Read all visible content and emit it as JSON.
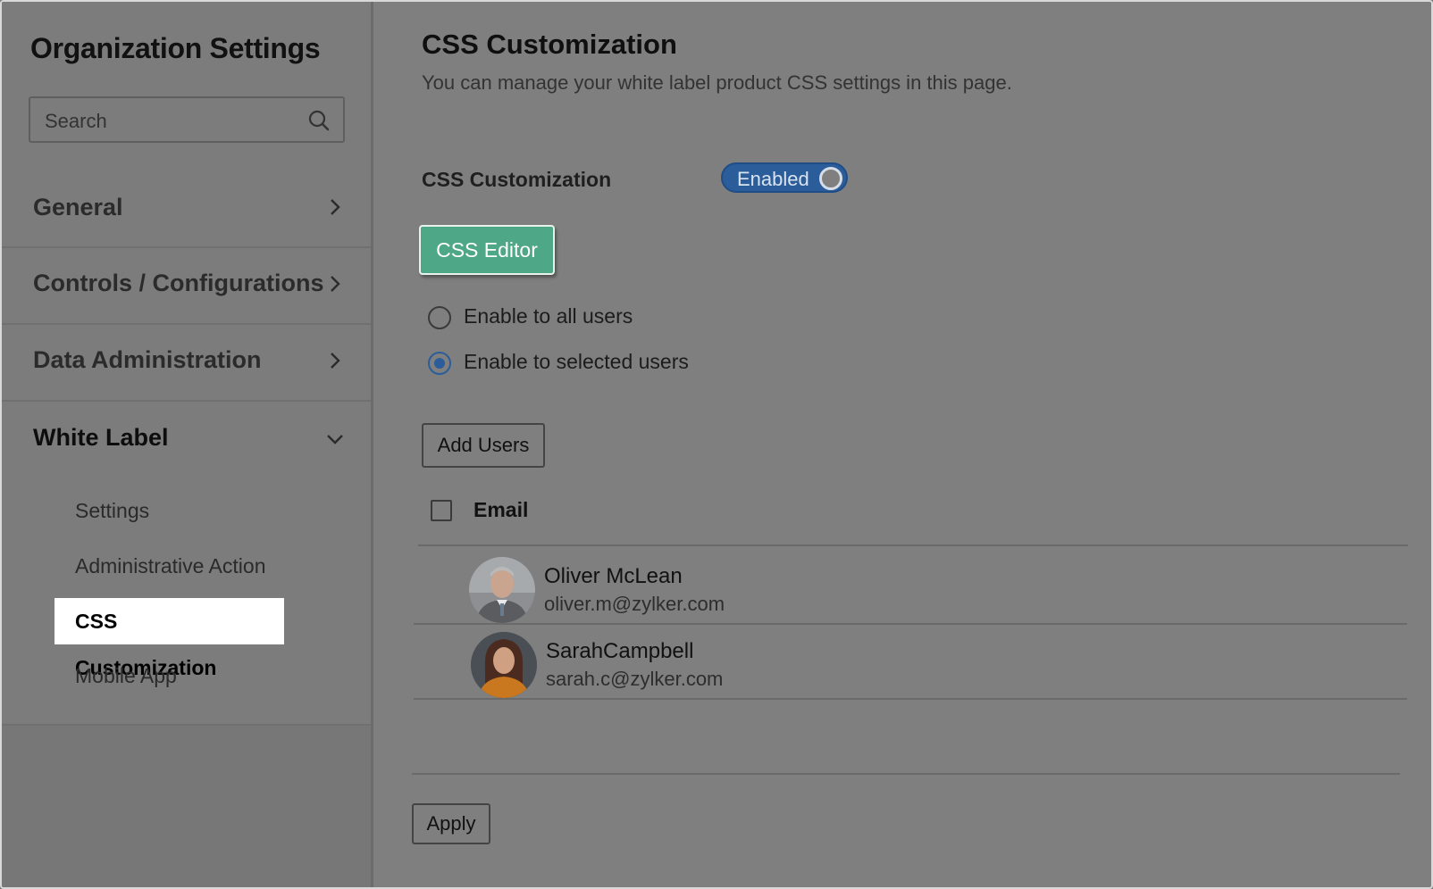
{
  "sidebar": {
    "title": "Organization Settings",
    "search": {
      "placeholder": "Search",
      "icon": "search-icon"
    },
    "sections": [
      {
        "label": "General",
        "icon": "chevron-right-icon"
      },
      {
        "label": "Controls / Configurations",
        "icon": "chevron-right-icon"
      },
      {
        "label": "Data Administration",
        "icon": "chevron-right-icon"
      },
      {
        "label": "White Label",
        "icon": "chevron-down-icon"
      }
    ],
    "white_label_items": [
      {
        "label": "Settings"
      },
      {
        "label": "Administrative Action"
      },
      {
        "label": "CSS Customization",
        "selected": true
      },
      {
        "label": "Mobile App"
      }
    ]
  },
  "main": {
    "title": "CSS Customization",
    "subtitle": "You can manage your white label product CSS settings in this page.",
    "css_label": "CSS Customization",
    "toggle": {
      "label": "Enabled",
      "state": "on",
      "color": "#2b5d9b"
    },
    "css_editor_button": "CSS Editor",
    "editor_color": "#4ea786",
    "options": [
      {
        "label": "Enable to all users",
        "checked": false
      },
      {
        "label": "Enable to selected users",
        "checked": true
      }
    ],
    "add_users_button": "Add Users",
    "table": {
      "header": "Email",
      "users": [
        {
          "name": "Oliver McLean",
          "email": "oliver.m@zylker.com",
          "avatar": "avatar-man"
        },
        {
          "name": "SarahCampbell",
          "email": "sarah.c@zylker.com",
          "avatar": "avatar-woman"
        }
      ]
    },
    "apply_button": "Apply"
  }
}
